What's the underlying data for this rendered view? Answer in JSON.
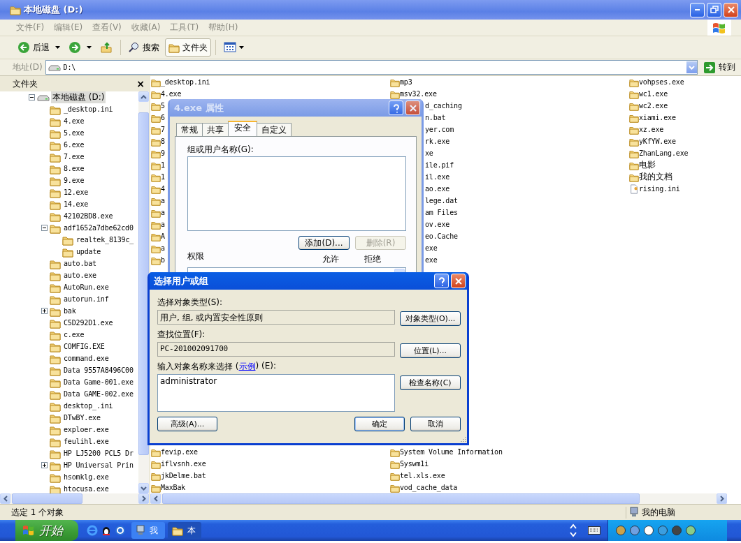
{
  "window": {
    "title": "本地磁盘 (D:)"
  },
  "menu": [
    "文件(F)",
    "编辑(E)",
    "查看(V)",
    "收藏(A)",
    "工具(T)",
    "帮助(H)"
  ],
  "toolbar": {
    "back": "后退",
    "search": "搜索",
    "folders": {
      "label": "文件夹",
      "selected": true
    }
  },
  "address": {
    "label": "地址(D)",
    "value": "D:\\",
    "go": "转到"
  },
  "tree": {
    "title": "文件夹",
    "close": "×",
    "items": [
      {
        "label": "本地磁盘 (D:)",
        "kind": "drive",
        "expanded": true,
        "selected": true,
        "children": [
          {
            "label": "_desktop.ini",
            "kind": "folder"
          },
          {
            "label": "4.exe",
            "kind": "folder"
          },
          {
            "label": "5.exe",
            "kind": "folder"
          },
          {
            "label": "6.exe",
            "kind": "folder"
          },
          {
            "label": "7.exe",
            "kind": "folder"
          },
          {
            "label": "8.exe",
            "kind": "folder"
          },
          {
            "label": "9.exe",
            "kind": "folder"
          },
          {
            "label": "12.exe",
            "kind": "folder"
          },
          {
            "label": "14.exe",
            "kind": "folder"
          },
          {
            "label": "42102BD8.exe",
            "kind": "folder"
          },
          {
            "label": "adf1652a7dbe62cd0",
            "kind": "folder",
            "expanded": true,
            "children": [
              {
                "label": "realtek_8139c_",
                "kind": "folder"
              },
              {
                "label": "update",
                "kind": "folder"
              }
            ]
          },
          {
            "label": "auto.bat",
            "kind": "folder"
          },
          {
            "label": "auto.exe",
            "kind": "folder"
          },
          {
            "label": "AutoRun.exe",
            "kind": "folder"
          },
          {
            "label": "autorun.inf",
            "kind": "folder"
          },
          {
            "label": "bak",
            "kind": "folder",
            "expanded": false
          },
          {
            "label": "C5D292D1.exe",
            "kind": "folder"
          },
          {
            "label": "c.exe",
            "kind": "folder"
          },
          {
            "label": "COMFIG.EXE",
            "kind": "folder"
          },
          {
            "label": "command.exe",
            "kind": "folder"
          },
          {
            "label": "Data 9557A8496C00",
            "kind": "folder"
          },
          {
            "label": "Data Game-001.exe",
            "kind": "folder"
          },
          {
            "label": "Data GAME-002.exe",
            "kind": "folder"
          },
          {
            "label": "desktop_.ini",
            "kind": "folder"
          },
          {
            "label": "DTwBY.exe",
            "kind": "folder"
          },
          {
            "label": "exploer.exe",
            "kind": "folder"
          },
          {
            "label": "feulihl.exe",
            "kind": "folder"
          },
          {
            "label": "HP LJ5200 PCL5 Dr",
            "kind": "folder"
          },
          {
            "label": "HP Universal Prin",
            "kind": "folder",
            "expanded": false
          },
          {
            "label": "hsomklg.exe",
            "kind": "folder"
          },
          {
            "label": "htocusa.exe",
            "kind": "folder"
          }
        ]
      }
    ]
  },
  "file_list": {
    "columns": [
      {
        "upper": [
          {
            "name": "_desktop.ini",
            "kind": "folder"
          },
          {
            "name": "4.exe",
            "kind": "folder"
          },
          {
            "name": "5",
            "kind": "folder"
          },
          {
            "name": "6",
            "kind": "folder"
          },
          {
            "name": "7",
            "kind": "folder"
          },
          {
            "name": "8",
            "kind": "folder"
          },
          {
            "name": "9",
            "kind": "folder"
          },
          {
            "name": "1",
            "kind": "folder"
          },
          {
            "name": "1",
            "kind": "folder"
          },
          {
            "name": "4",
            "kind": "folder"
          },
          {
            "name": "a",
            "kind": "folder"
          },
          {
            "name": "a",
            "kind": "folder"
          },
          {
            "name": "a",
            "kind": "folder"
          },
          {
            "name": "A",
            "kind": "folder"
          },
          {
            "name": "a",
            "kind": "folder"
          },
          {
            "name": "b",
            "kind": "folder"
          }
        ],
        "lower": [
          {
            "name": "fevip.exe",
            "kind": "folder"
          },
          {
            "name": "iflvsnh.exe",
            "kind": "folder"
          },
          {
            "name": "jkDelme.bat",
            "kind": "folder"
          },
          {
            "name": "MaxBak",
            "kind": "folder"
          }
        ]
      },
      {
        "upper": [
          {
            "name": "mp3",
            "kind": "folder"
          },
          {
            "name": "msv32.exe",
            "kind": "folder"
          },
          {
            "name": "d_caching",
            "kind": "tail"
          },
          {
            "name": "n.bat",
            "kind": "tail"
          },
          {
            "name": "yer.com",
            "kind": "tail"
          },
          {
            "name": "rk.exe",
            "kind": "tail"
          },
          {
            "name": "xe",
            "kind": "tail"
          },
          {
            "name": "ile.pif",
            "kind": "tail"
          },
          {
            "name": "il.exe",
            "kind": "tail"
          },
          {
            "name": "ao.exe",
            "kind": "tail"
          },
          {
            "name": "lege.dat",
            "kind": "tail"
          },
          {
            "name": "am Files",
            "kind": "tail"
          },
          {
            "name": "ov.exe",
            "kind": "tail"
          },
          {
            "name": "eo.Cache",
            "kind": "tail"
          },
          {
            "name": "exe",
            "kind": "tail"
          },
          {
            "name": "exe",
            "kind": "tail"
          }
        ],
        "lower": [
          {
            "name": "System Volume Information",
            "kind": "folder"
          },
          {
            "name": "Syswm1i",
            "kind": "folder"
          },
          {
            "name": "tel.xls.exe",
            "kind": "folder"
          },
          {
            "name": "vod_cache_data",
            "kind": "folder"
          }
        ]
      },
      {
        "upper": [
          {
            "name": "vohpses.exe",
            "kind": "folder"
          },
          {
            "name": "wc1.exe",
            "kind": "folder"
          },
          {
            "name": "wc2.exe",
            "kind": "folder"
          },
          {
            "name": "xiami.exe",
            "kind": "folder"
          },
          {
            "name": "xz.exe",
            "kind": "folder"
          },
          {
            "name": "yKfYW.exe",
            "kind": "folder"
          },
          {
            "name": "ZhanLang.exe",
            "kind": "folder"
          },
          {
            "name": "电影",
            "kind": "folder"
          },
          {
            "name": "我的文档",
            "kind": "folder"
          },
          {
            "name": "rising.ini",
            "kind": "file"
          }
        ]
      }
    ]
  },
  "status_bar": {
    "text": "选定 1 个对象",
    "location": "我的电脑"
  },
  "properties_dialog": {
    "title": "4.exe 属性",
    "active": false,
    "tabs": [
      {
        "label": "常规",
        "selected": false
      },
      {
        "label": "共享",
        "selected": false
      },
      {
        "label": "安全",
        "selected": true
      },
      {
        "label": "自定义",
        "selected": false
      }
    ],
    "group_label": "组或用户名称(G):",
    "buttons": [
      {
        "label": "添加(D)...",
        "disabled": false
      },
      {
        "label": "删除(R)",
        "disabled": true
      }
    ],
    "permissions_label": "权限",
    "columns": [
      "允许",
      "拒绝"
    ]
  },
  "select_dialog": {
    "title": "选择用户或组",
    "active": true,
    "object_type": {
      "label": "选择对象类型(S):",
      "value": "用户, 组, 或内置安全性原则",
      "button": "对象类型(O)..."
    },
    "location": {
      "label": "查找位置(F):",
      "value": "PC-201002091700",
      "button": "位置(L)..."
    },
    "names": {
      "label_before": "输入对象名称来选择 (",
      "link": "示例",
      "label_after": ") (E):",
      "value": "administrator",
      "button": "检查名称(C)"
    },
    "advanced": "高级(A)...",
    "ok": "确定",
    "cancel": "取消"
  },
  "taskbar": {
    "start": "开始",
    "tasks": [
      {
        "label": "我",
        "kind": "computer",
        "selected": false
      },
      {
        "label": "本",
        "kind": "folder",
        "selected": true
      }
    ]
  }
}
